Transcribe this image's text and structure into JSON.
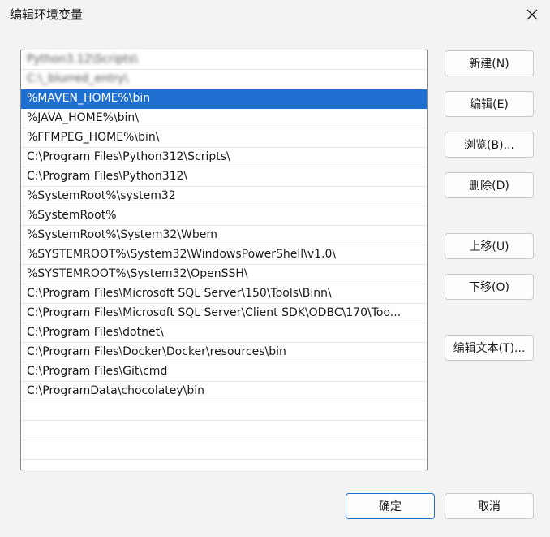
{
  "window": {
    "title": "编辑环境变量"
  },
  "list": {
    "items": [
      "Python3.12\\Scripts\\",
      "C:\\_blurred_entry\\",
      "%MAVEN_HOME%\\bin",
      "%JAVA_HOME%\\bin\\",
      "%FFMPEG_HOME%\\bin\\",
      "C:\\Program Files\\Python312\\Scripts\\",
      "C:\\Program Files\\Python312\\",
      "%SystemRoot%\\system32",
      "%SystemRoot%",
      "%SystemRoot%\\System32\\Wbem",
      "%SYSTEMROOT%\\System32\\WindowsPowerShell\\v1.0\\",
      "%SYSTEMROOT%\\System32\\OpenSSH\\",
      "C:\\Program Files\\Microsoft SQL Server\\150\\Tools\\Binn\\",
      "C:\\Program Files\\Microsoft SQL Server\\Client SDK\\ODBC\\170\\Too...",
      "C:\\Program Files\\dotnet\\",
      "C:\\Program Files\\Docker\\Docker\\resources\\bin",
      "C:\\Program Files\\Git\\cmd",
      "C:\\ProgramData\\chocolatey\\bin"
    ],
    "selected_index": 2,
    "blurred_indices": [
      0,
      1
    ]
  },
  "buttons": {
    "new": "新建(N)",
    "edit": "编辑(E)",
    "browse": "浏览(B)...",
    "delete": "删除(D)",
    "move_up": "上移(U)",
    "move_down": "下移(O)",
    "edit_text": "编辑文本(T)...",
    "ok": "确定",
    "cancel": "取消"
  },
  "colors": {
    "selection": "#1f6fd1",
    "window_bg": "#f3f3f3",
    "primary_border": "#1f6fd1"
  },
  "icons": {
    "close": "close-icon"
  }
}
